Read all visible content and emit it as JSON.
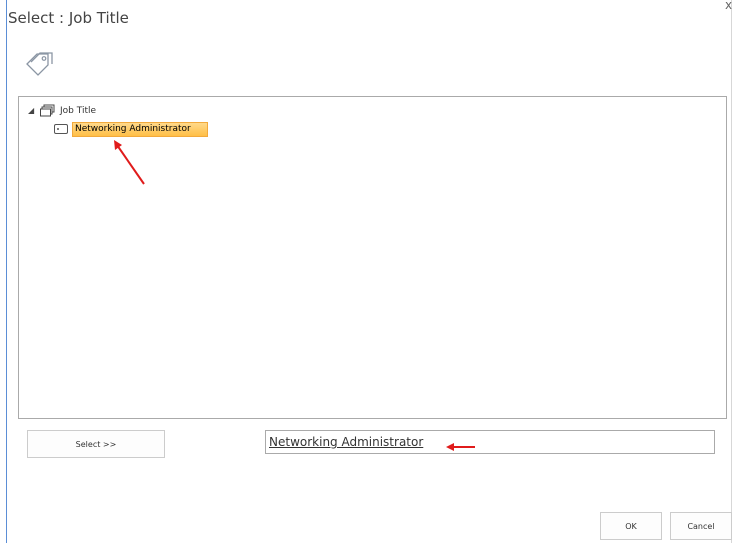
{
  "dialog": {
    "title": "Select : Job Title",
    "close_glyph": "x"
  },
  "header": {
    "icon": "tag-icon"
  },
  "tree": {
    "root": {
      "label": "Job Title",
      "toggle_glyph": "◢",
      "icon": "termset-icon"
    },
    "children": [
      {
        "label": "Networking Administrator",
        "icon": "term-icon",
        "selected": true
      }
    ]
  },
  "actions": {
    "select_label": "Select >>",
    "selected_value": "Networking Administrator",
    "ok_label": "OK",
    "cancel_label": "Cancel"
  },
  "annotations": {
    "arrow_color": "#e01b1b"
  },
  "colors": {
    "highlight_start": "#ffd98a",
    "highlight_end": "#ffbf47",
    "frame_accent": "#5b8ed6"
  }
}
